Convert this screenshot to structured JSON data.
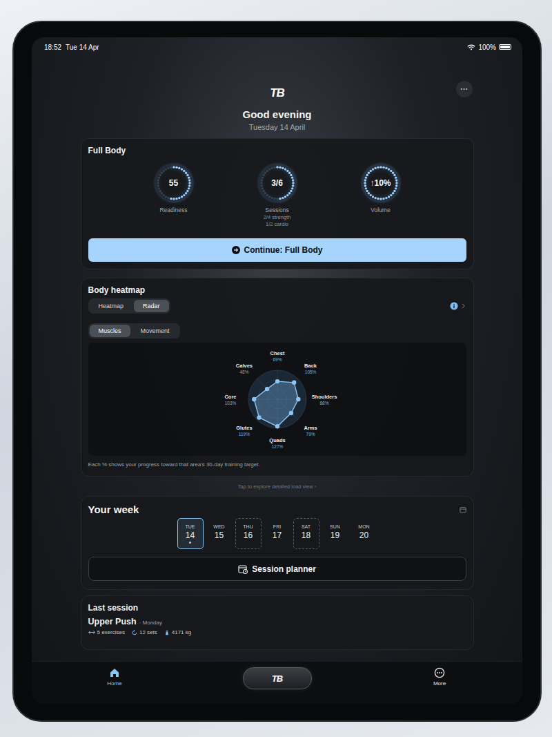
{
  "status_bar": {
    "time": "18:52",
    "date": "Tue 14 Apr",
    "battery": "100%",
    "battery_level": 1
  },
  "header": {
    "logo": "TB",
    "greeting": "Good evening",
    "date": "Tuesday 14 April"
  },
  "plan_card": {
    "title": "Full Body",
    "rings": [
      {
        "value": "55",
        "label": "Readiness",
        "details": [],
        "level": 0.55
      },
      {
        "value": "3/6",
        "label": "Sessions",
        "details": [
          "2/4 strength",
          "1/2 cardio"
        ],
        "level": 0.5
      },
      {
        "value": "↑10%",
        "label": "Volume",
        "details": [],
        "level": 1
      }
    ],
    "button": "Continue: Full Body"
  },
  "heatmap_card": {
    "title": "Body heatmap",
    "view_tabs": [
      {
        "label": "Heatmap",
        "selected": false
      },
      {
        "label": "Radar",
        "selected": true
      }
    ],
    "mode_tabs": [
      {
        "label": "Muscles",
        "selected": true
      },
      {
        "label": "Movement",
        "selected": false
      }
    ],
    "radar": {
      "axes": [
        {
          "name": "Chest",
          "reading": "69%",
          "value": 69,
          "color": "#6fb3ee"
        },
        {
          "name": "Back",
          "reading": "105%",
          "value": 105,
          "color": "#6fb3ee"
        },
        {
          "name": "Shoulders",
          "reading": "88%",
          "value": 88,
          "color": "#6fb3ee"
        },
        {
          "name": "Arms",
          "reading": "79%",
          "value": 79,
          "color": "#6fb3ee"
        },
        {
          "name": "Quads",
          "reading": "127%",
          "value": 127,
          "color": "#6fb3ee"
        },
        {
          "name": "Glutes",
          "reading": "119%",
          "value": 119,
          "color": "#6fb3ee"
        },
        {
          "name": "Core",
          "reading": "103%",
          "value": 103,
          "color": "#6fb3ee"
        },
        {
          "name": "Calves",
          "reading": "48%",
          "value": 48,
          "color": "#9aa0a8"
        }
      ]
    },
    "caption": "Each % shows your progress toward that area's 30-day training target.",
    "hint": "Tap to explore detailed load view ›"
  },
  "week": {
    "title": "Your week",
    "days": [
      {
        "weekday": "TUE",
        "day": "14",
        "selected": true,
        "planned": false,
        "marked": true
      },
      {
        "weekday": "WED",
        "day": "15",
        "selected": false,
        "planned": false,
        "marked": false
      },
      {
        "weekday": "THU",
        "day": "16",
        "selected": false,
        "planned": true,
        "marked": false
      },
      {
        "weekday": "FRI",
        "day": "17",
        "selected": false,
        "planned": false,
        "marked": false
      },
      {
        "weekday": "SAT",
        "day": "18",
        "selected": false,
        "planned": true,
        "marked": false
      },
      {
        "weekday": "SUN",
        "day": "19",
        "selected": false,
        "planned": false,
        "marked": false
      },
      {
        "weekday": "MON",
        "day": "20",
        "selected": false,
        "planned": false,
        "marked": false
      }
    ],
    "button": "Session planner"
  },
  "last_session": {
    "title": "Last session",
    "name": "Upper Push",
    "day": "· Monday",
    "exercises": "5 exercises",
    "sets": "12 sets",
    "volume": "4171 kg"
  },
  "tab_bar": {
    "items": [
      {
        "label": "Home",
        "selected": true
      },
      {
        "label": "More",
        "selected": false
      }
    ],
    "center_logo": "TB"
  }
}
